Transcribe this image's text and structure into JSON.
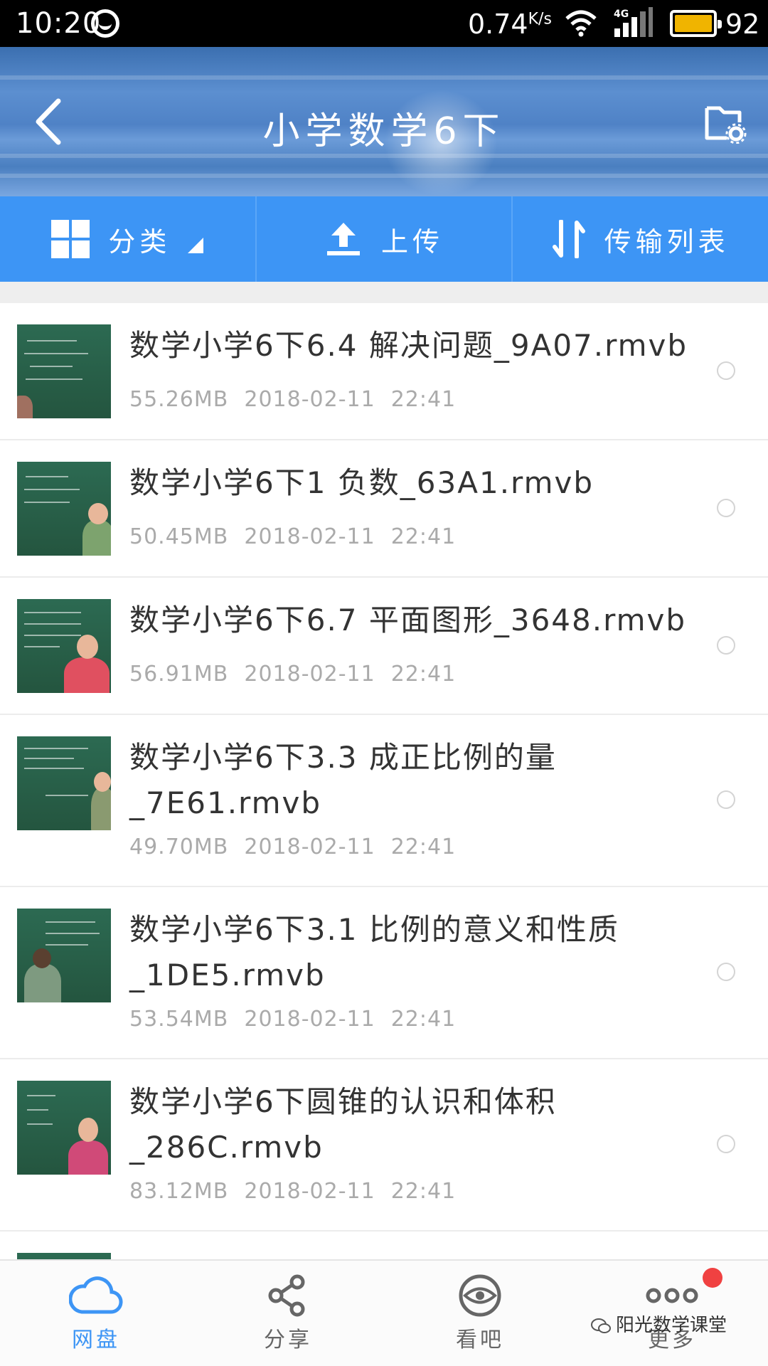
{
  "status_bar": {
    "time": "10:20",
    "speed_value": "0.74",
    "speed_unit": "K/s",
    "network": "4G",
    "battery_level": "92"
  },
  "header": {
    "title": "小学数学6下"
  },
  "actions": [
    {
      "label": "分类",
      "icon": "grid-icon"
    },
    {
      "label": "上传",
      "icon": "upload-icon"
    },
    {
      "label": "传输列表",
      "icon": "transfer-icon"
    }
  ],
  "files": [
    {
      "name": "数学小学6下6.4 解决问题_9A07.rmvb",
      "size": "55.26MB",
      "date": "2018-02-11",
      "time": "22:41"
    },
    {
      "name": "数学小学6下1 负数_63A1.rmvb",
      "size": "50.45MB",
      "date": "2018-02-11",
      "time": "22:41"
    },
    {
      "name": "数学小学6下6.7 平面图形_3648.rmvb",
      "size": "56.91MB",
      "date": "2018-02-11",
      "time": "22:41"
    },
    {
      "name": "数学小学6下3.3 成正比例的量_7E61.rmvb",
      "size": "49.70MB",
      "date": "2018-02-11",
      "time": "22:41"
    },
    {
      "name": "数学小学6下3.1 比例的意义和性质_1DE5.rmvb",
      "size": "53.54MB",
      "date": "2018-02-11",
      "time": "22:41"
    },
    {
      "name": "数学小学6下圆锥的认识和体积_286C.rmvb",
      "size": "83.12MB",
      "date": "2018-02-11",
      "time": "22:41"
    }
  ],
  "bottom_nav": [
    {
      "label": "网盘",
      "icon": "cloud-icon",
      "active": true
    },
    {
      "label": "分享",
      "icon": "share-icon",
      "active": false
    },
    {
      "label": "看吧",
      "icon": "eye-icon",
      "active": false
    },
    {
      "label": "更多",
      "icon": "more-icon",
      "active": false
    }
  ],
  "watermark": "阳光数学课堂",
  "colors": {
    "accent": "#3d95f5",
    "badge": "#f04141",
    "battery": "#f0b400"
  }
}
